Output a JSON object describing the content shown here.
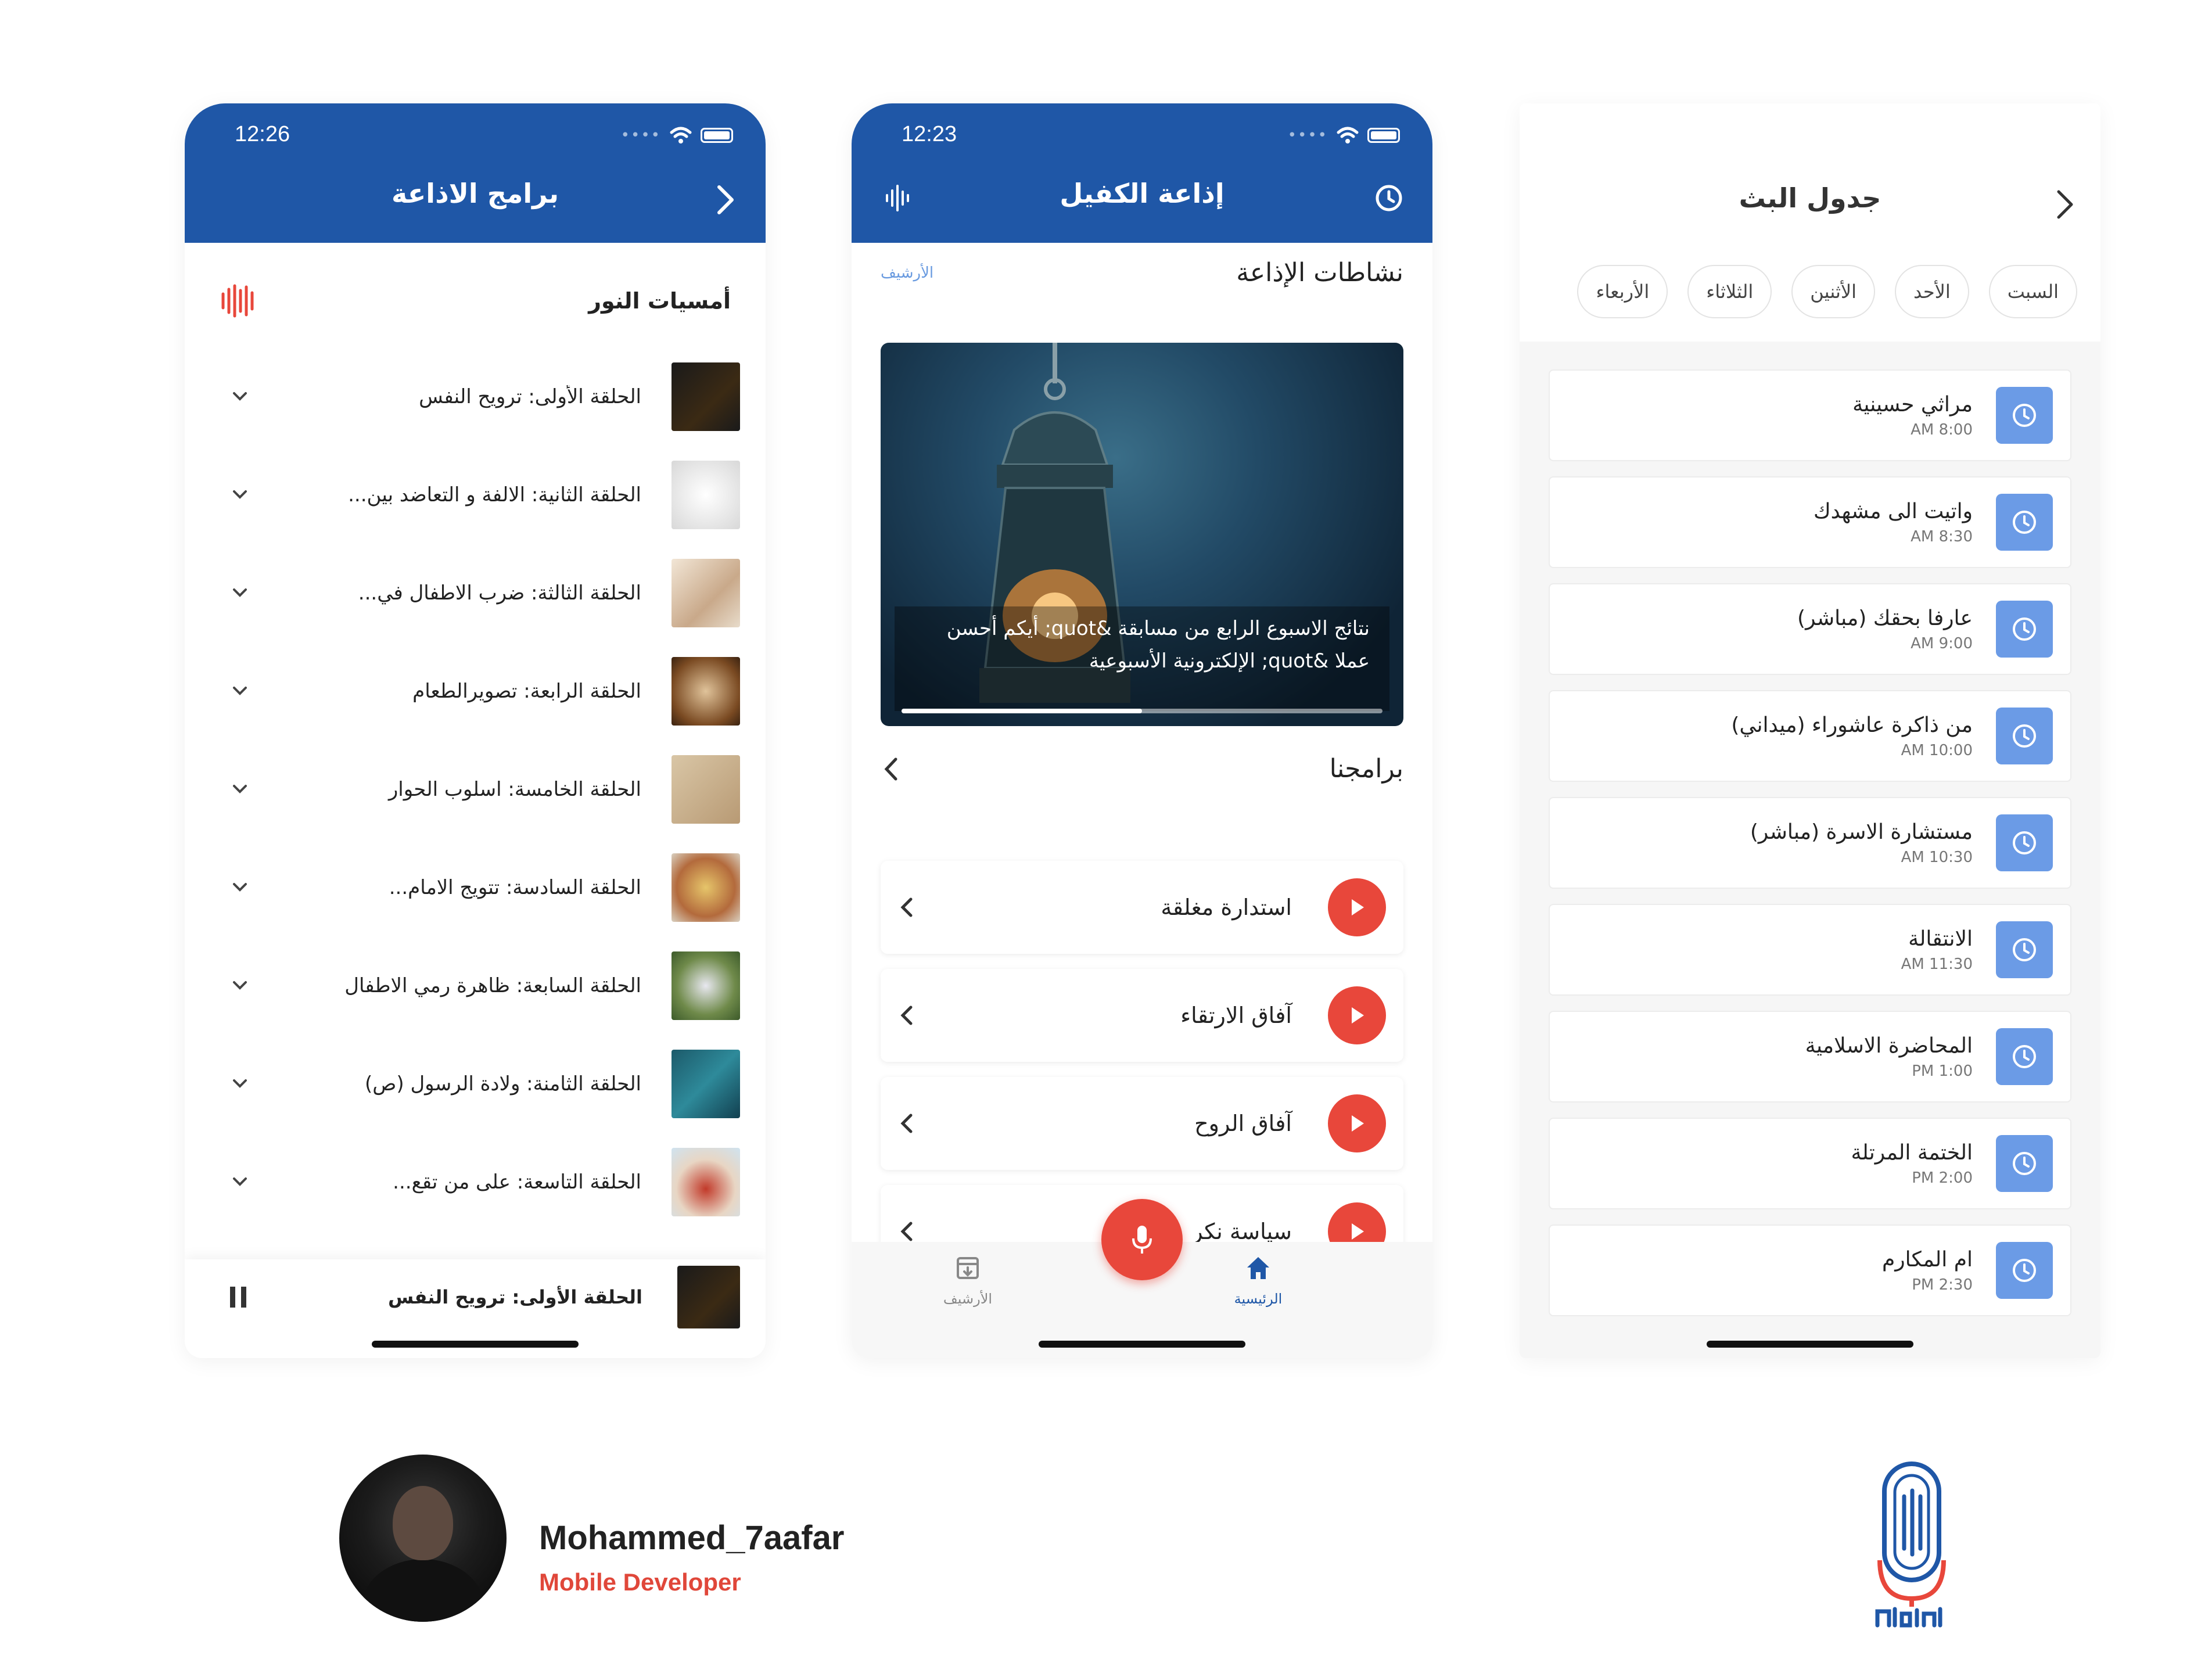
{
  "phone1": {
    "status_time": "12:26",
    "title": "برامج الاذاعة",
    "program_title": "أمسيات النور",
    "episodes": [
      "الحلقة الأولى: ترويح النفس",
      "الحلقة الثانية: الالفة و التعاضد بين...",
      "الحلقة الثالثة: ضرب الاطفال في...",
      "الحلقة الرابعة: تصويرالطعام",
      "الحلقة الخامسة: اسلوب الحوار",
      "الحلقة السادسة: تتويج الامام...",
      "الحلقة السابعة: ظاهرة رمي الاطفال",
      "الحلقة الثامنة: ولادة الرسول (ص)",
      "الحلقة التاسعة: على من تقع..."
    ],
    "now_playing": "الحلقة الأولى: ترويح النفس"
  },
  "phone2": {
    "status_time": "12:23",
    "title": "إذاعة الكفيل",
    "activities_title": "نشاطات الإذاعة",
    "archive_link": "الأرشيف",
    "hero_caption": "نتائج الاسبوع الرابع من مسابقة &quot; أيكم أحسن عملا &quot; الإلكترونية الأسبوعية",
    "hero_progress": 0.5,
    "programs_title": "برامجنا",
    "programs": [
      "استدارة مغلقة",
      "آفاق الارتقاء",
      "آفاق الروح",
      "سياسة نكر"
    ],
    "tabs": {
      "home": "الرئيسية",
      "archive": "الأرشيف"
    },
    "colors": {
      "primary": "#1f57a7",
      "accent": "#e8473b"
    }
  },
  "phone3": {
    "title": "جدول البث",
    "days": [
      "السبت",
      "الأحد",
      "الأثنين",
      "الثلاثاء",
      "الأربعاء"
    ],
    "schedule": [
      {
        "show": "مراثي حسينية",
        "time": "AM 8:00"
      },
      {
        "show": "واتيت الى مشهدك",
        "time": "AM 8:30"
      },
      {
        "show": "عارفا بحقك (مباشر)",
        "time": "AM 9:00"
      },
      {
        "show": "من ذاكرة عاشوراء (ميداني)",
        "time": "AM 10:00"
      },
      {
        "show": "مستشارة الاسرة (مباشر)",
        "time": "AM 10:30"
      },
      {
        "show": "الانتقالة",
        "time": "AM 11:30"
      },
      {
        "show": "المحاضرة الاسلامية",
        "time": "PM 1:00"
      },
      {
        "show": "الختمة المرتلة",
        "time": "PM 2:00"
      },
      {
        "show": "ام المكارم",
        "time": "PM 2:30"
      }
    ]
  },
  "footer": {
    "developer_name": "Mohammed_7aafar",
    "developer_role": "Mobile Developer",
    "logo_text": "اذاعة الكفيل"
  }
}
